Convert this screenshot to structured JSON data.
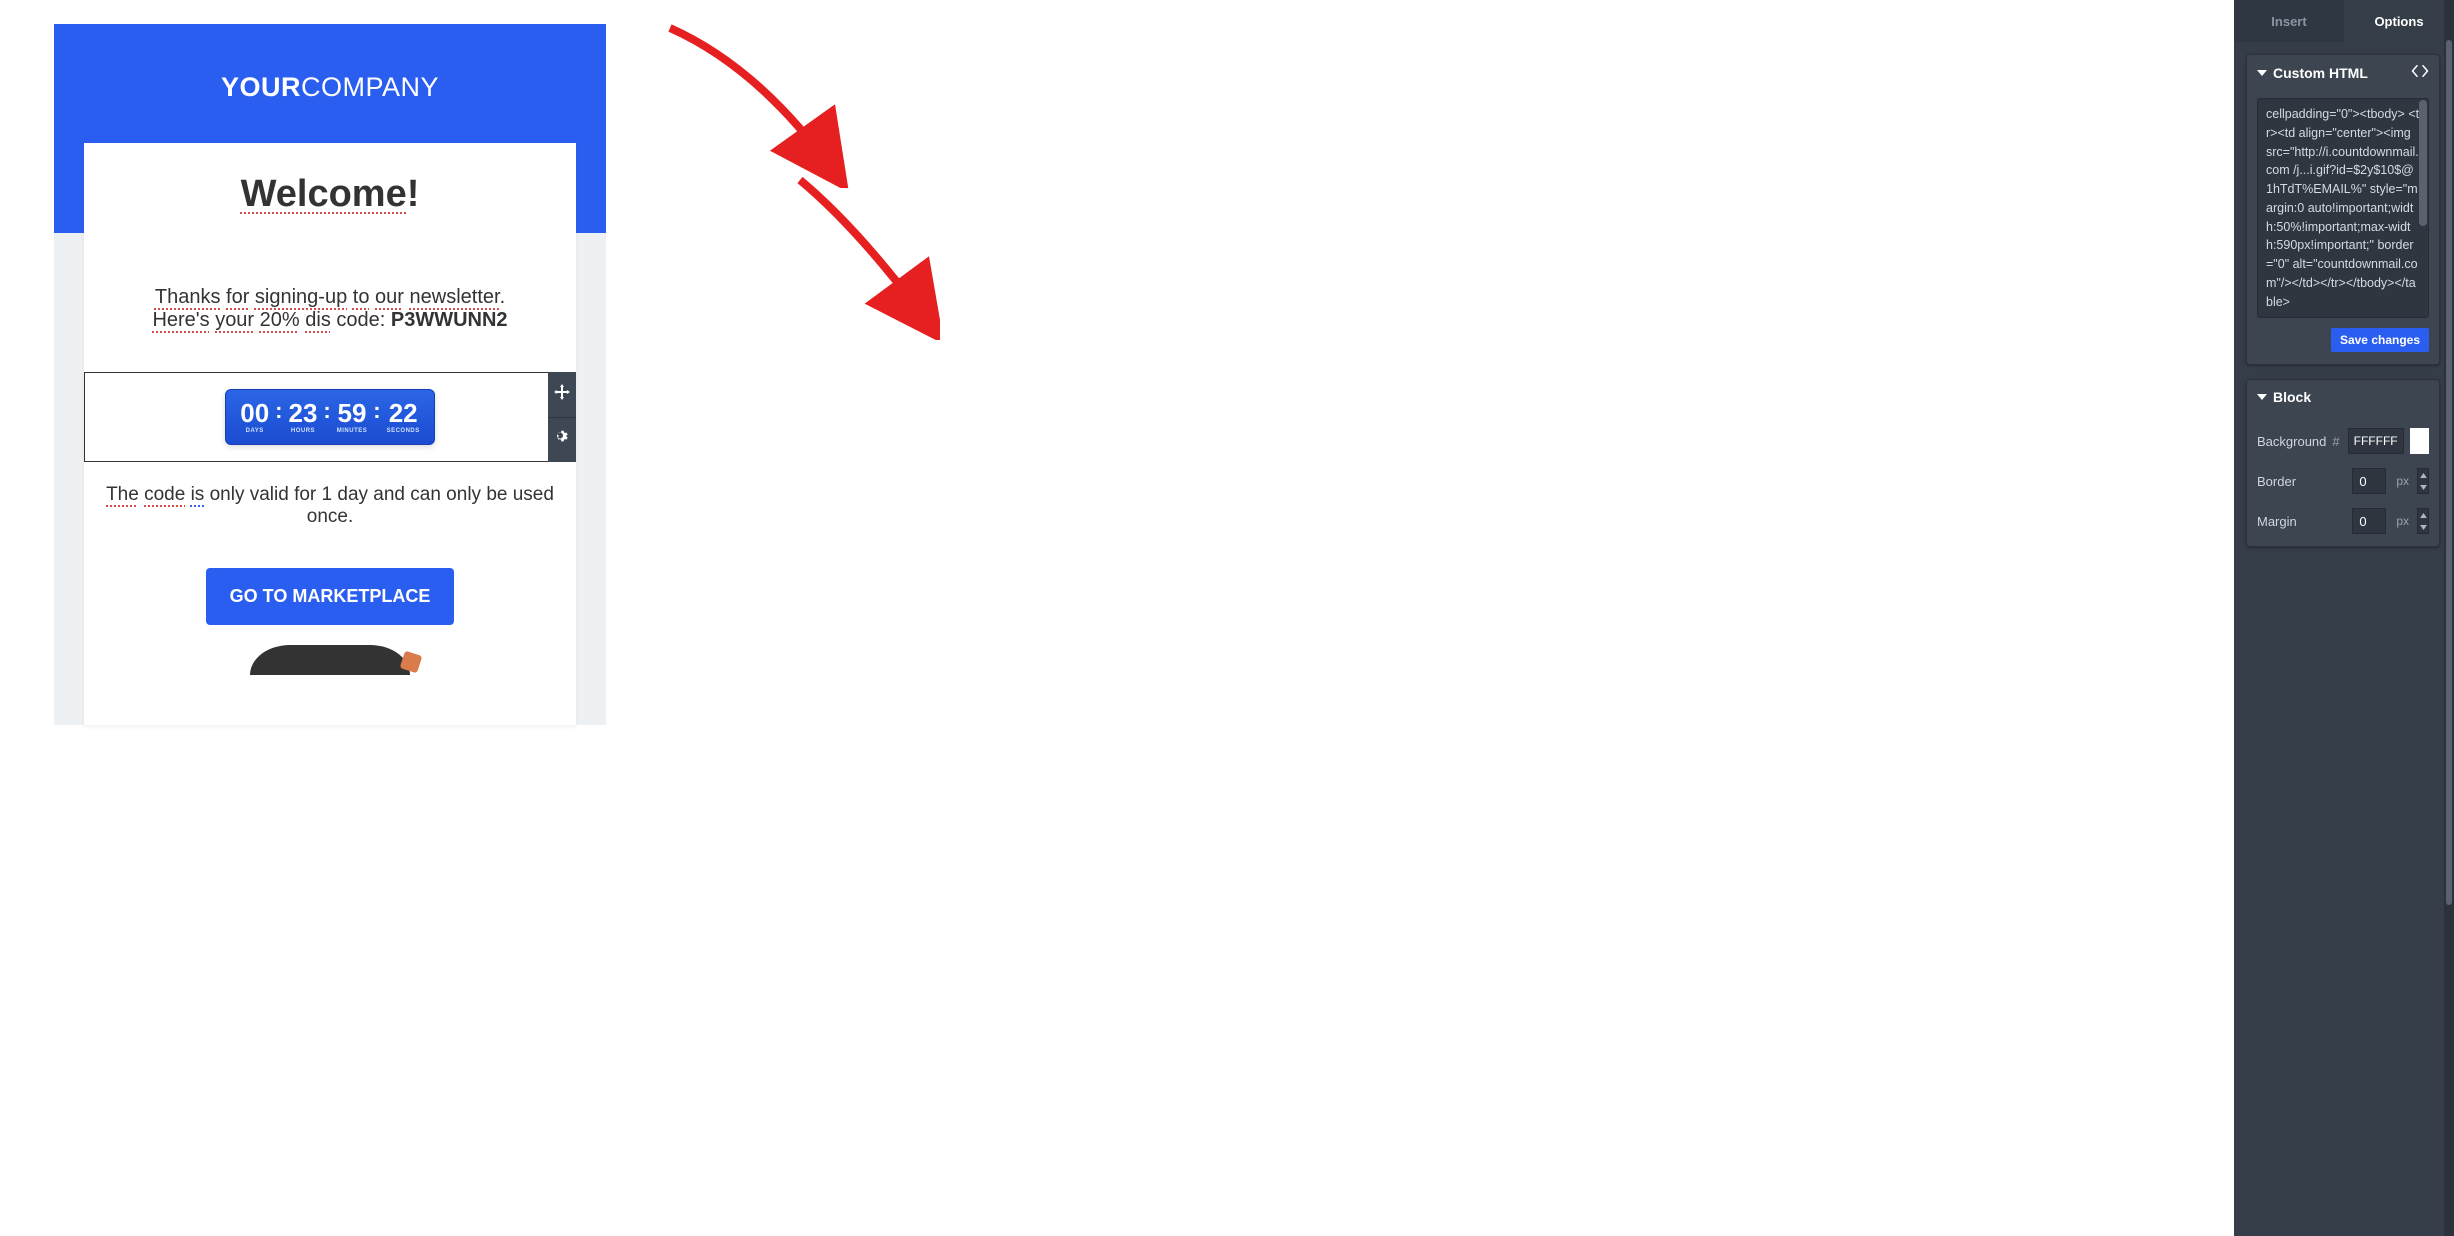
{
  "email": {
    "brand_bold": "YOUR",
    "brand_light": "COMPANY",
    "welcome_underlined": "Welcome",
    "welcome_tail": "!",
    "thanks_segments": [
      {
        "t": "Thanks",
        "u": true,
        "c": "red"
      },
      {
        "t": " "
      },
      {
        "t": "for",
        "u": true,
        "c": "red"
      },
      {
        "t": " "
      },
      {
        "t": "signing-up",
        "u": true,
        "c": "red"
      },
      {
        "t": " "
      },
      {
        "t": "to",
        "u": true,
        "c": "red"
      },
      {
        "t": " "
      },
      {
        "t": "our",
        "u": true,
        "c": "red"
      },
      {
        "t": " "
      },
      {
        "t": "newsletter",
        "u": true,
        "c": "red"
      },
      {
        "t": "."
      }
    ],
    "codeline_prefix_segments": [
      {
        "t": "Here's",
        "u": true,
        "c": "red"
      },
      {
        "t": " "
      },
      {
        "t": "your",
        "u": true,
        "c": "red"
      },
      {
        "t": " "
      },
      {
        "t": "20%",
        "u": true,
        "c": "red"
      },
      {
        "t": " "
      },
      {
        "t": "dis",
        "u": true,
        "c": "red"
      }
    ],
    "codeline_mid": "       code: ",
    "codeline_code": "P3WWUNN2",
    "countdown": {
      "days": {
        "v": "00",
        "l": "DAYS"
      },
      "hours": {
        "v": "23",
        "l": "HOURS"
      },
      "minutes": {
        "v": "59",
        "l": "MINUTES"
      },
      "seconds": {
        "v": "22",
        "l": "SECONDS"
      },
      "sep": ":"
    },
    "validity_segments": [
      {
        "t": "The",
        "u": true,
        "c": "red"
      },
      {
        "t": " "
      },
      {
        "t": "code",
        "u": true,
        "c": "red"
      },
      {
        "t": " "
      },
      {
        "t": "is",
        "u": true,
        "c": "blue"
      },
      {
        "t": " only valid for 1 day and can only be used once."
      }
    ],
    "cta": "GO TO MARKETPLACE"
  },
  "panel": {
    "tabs": {
      "insert": "Insert",
      "options": "Options"
    },
    "custom_html_title": "Custom HTML",
    "custom_html_code": "cellpadding=\"0\"><tbody>\n<tr><td align=\"center\"><img src=\"http://i.countdownmail.com\n/j...i.gif?id=$2y$10$@1hTdT%EMAIL%\" style=\"margin:0 auto!important;width:50%!important;max-width:590px!important;\" border=\"0\" alt=\"countdownmail.com\"/></td></tr></tbody></table>",
    "save_label": "Save changes",
    "block_title": "Block",
    "block": {
      "background_label": "Background",
      "background_value": "FFFFFF",
      "border_label": "Border",
      "border_value": "0",
      "border_unit": "px",
      "margin_label": "Margin",
      "margin_value": "0",
      "margin_unit": "px"
    },
    "hash": "#"
  }
}
